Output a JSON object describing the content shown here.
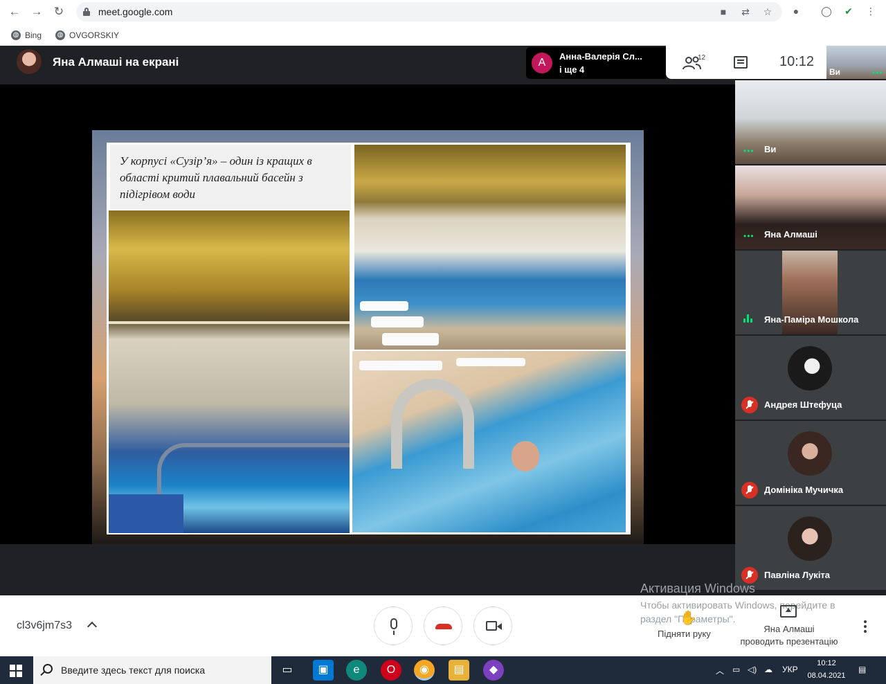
{
  "browser": {
    "url": "meet.google.com",
    "bookmarks": [
      {
        "label": "Bing"
      },
      {
        "label": "OVGORSKIY"
      }
    ]
  },
  "meet": {
    "presenter_title": "Яна Алмаші на екрані",
    "active_speaker": {
      "initial": "A",
      "name": "Анна-Валерія Сл...",
      "more": "і ще 4",
      "avatar_color": "#c2185b"
    },
    "participant_count": "12",
    "clock": "10:12",
    "self_label": "Ви",
    "slide": {
      "caption": "У корпусі «Сузір’я» – один із кращих в області критий плавальний басейн з підігрівом води"
    },
    "tiles": [
      {
        "name": "Ви",
        "state": "self-video"
      },
      {
        "name": "Яна Алмаші",
        "state": "video"
      },
      {
        "name": "Яна-Паміра Мошкола",
        "state": "speaking"
      },
      {
        "name": "Андрея Штефуца",
        "state": "muted"
      },
      {
        "name": "Домініка Мучичка",
        "state": "muted"
      },
      {
        "name": "Павліна Лукіта",
        "state": "muted"
      }
    ],
    "meeting_code": "cl3v6jm7s3",
    "raise_hand_label": "Підняти руку",
    "presenting_label_1": "Яна Алмаші",
    "presenting_label_2": "проводить презентацію",
    "accent_red": "#d93025",
    "accent_green": "#00e676"
  },
  "watermark": {
    "line1": "Активация Windows",
    "line2": "Чтобы активировать Windows, перейдите в раздел \"Параметры\"."
  },
  "taskbar": {
    "search_placeholder": "Введите здесь текст для поиска",
    "language": "УКР",
    "time": "10:12",
    "date": "08.04.2021"
  }
}
